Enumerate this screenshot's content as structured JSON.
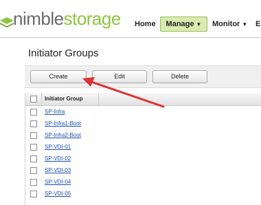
{
  "brand": {
    "part1": "nimble",
    "part2": "storage",
    "color_primary": "#6a6a6a",
    "color_accent": "#8dc63f"
  },
  "nav": {
    "home": "Home",
    "manage": "Manage",
    "monitor": "Monitor",
    "more": "E",
    "active": "Manage",
    "active_color": "#d8ebb0"
  },
  "page": {
    "title": "Initiator Groups"
  },
  "toolbar": {
    "create": "Create",
    "edit": "Edit",
    "delete": "Delete"
  },
  "grid": {
    "header": "Initiator Group",
    "rows": [
      "SP-Infra",
      "SP-Infra1-Boot",
      "SP-Infra2-Boot",
      "SP-VDI-01",
      "SP-VDI-02",
      "SP-VDI-03",
      "SP-VDI-04",
      "SP-VDI-05"
    ]
  },
  "annotation": {
    "arrow_color": "#e03030",
    "points_to": "Create"
  }
}
